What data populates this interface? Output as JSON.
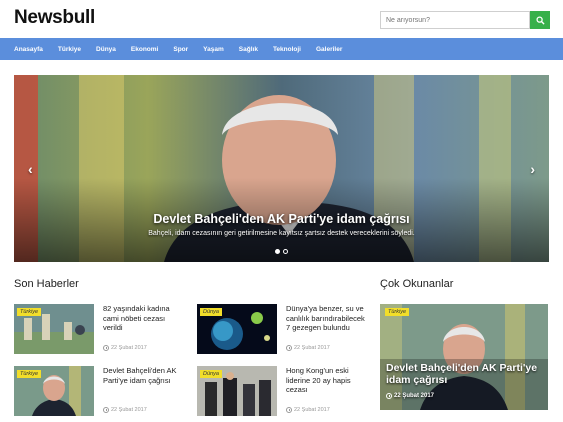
{
  "site": {
    "logo": "Newsbull"
  },
  "search": {
    "placeholder": "Ne arıyorsun?"
  },
  "nav": {
    "items": [
      "Anasayfa",
      "Türkiye",
      "Dünya",
      "Ekonomi",
      "Spor",
      "Yaşam",
      "Sağlık",
      "Teknoloji",
      "Galeriler"
    ]
  },
  "slider": {
    "title": "Devlet Bahçeli'den AK Parti'ye idam çağrısı",
    "subtitle": "Bahçeli, idam cezasının geri getirilmesine kayıtsız şartsız destek vereceklerini söyledi.",
    "prev_icon": "chevron-left-icon",
    "next_icon": "chevron-right-icon",
    "dots": 2,
    "active_dot": 1
  },
  "son_haberler": {
    "title": "Son Haberler",
    "items": [
      {
        "category": "Türkiye",
        "title": "82 yaşındaki kadına cami nöbeti cezası verildi",
        "date": "22 Şubat 2017"
      },
      {
        "category": "Dünya",
        "title": "Dünya'ya benzer, su ve canlılık barındırabilecek 7 gezegen bulundu",
        "date": "22 Şubat 2017"
      },
      {
        "category": "Türkiye",
        "title": "Devlet Bahçeli'den AK Parti'ye idam çağrısı",
        "date": "22 Şubat 2017"
      },
      {
        "category": "Dünya",
        "title": "Hong Kong'un eski liderine 20 ay hapis cezası",
        "date": "22 Şubat 2017"
      }
    ]
  },
  "cok_okunanlar": {
    "title": "Çok Okunanlar",
    "item": {
      "category": "Türkiye",
      "title": "Devlet Bahçeli'den AK Parti'ye idam çağrısı",
      "date": "22 Şubat 2017"
    }
  },
  "colors": {
    "nav": "#5b8edc",
    "search_button": "#37b04a",
    "badge": "#f2de2a"
  }
}
